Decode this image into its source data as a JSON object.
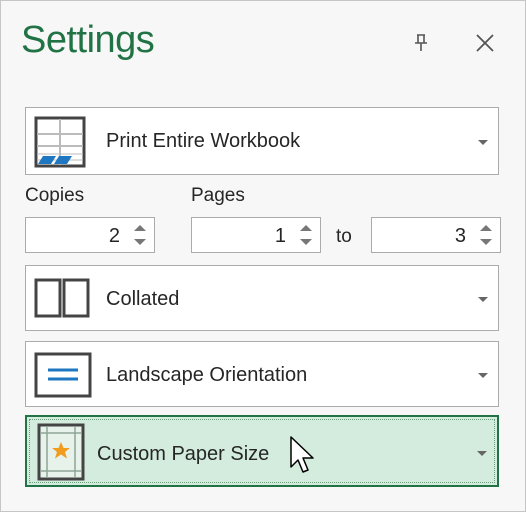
{
  "header": {
    "title": "Settings",
    "pin_icon": "pin-icon",
    "close_icon": "close-icon"
  },
  "print_what": {
    "label": "Print Entire Workbook",
    "icon": "workbook-icon"
  },
  "copies": {
    "label": "Copies",
    "value": "2"
  },
  "pages": {
    "label": "Pages",
    "from": "1",
    "to_label": "to",
    "to": "3"
  },
  "collation": {
    "label": "Collated",
    "icon": "collated-icon"
  },
  "orientation": {
    "label": "Landscape Orientation",
    "icon": "landscape-icon"
  },
  "paper_size": {
    "label": "Custom Paper Size",
    "icon": "custom-paper-icon"
  },
  "colors": {
    "accent": "#217346",
    "selected_bg": "#d3ecdd",
    "icon_blue": "#1e77c0",
    "star": "#f29c1f"
  }
}
